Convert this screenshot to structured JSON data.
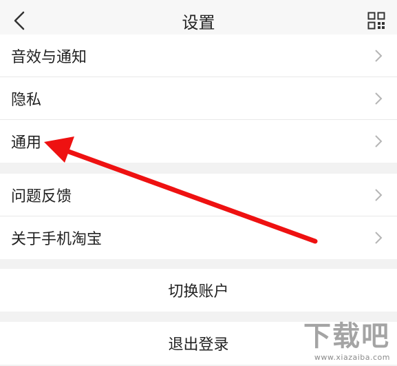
{
  "header": {
    "title": "设置"
  },
  "group1": {
    "items": [
      {
        "label": "音效与通知"
      },
      {
        "label": "隐私"
      },
      {
        "label": "通用"
      }
    ]
  },
  "group2": {
    "items": [
      {
        "label": "问题反馈"
      },
      {
        "label": "关于手机淘宝"
      }
    ]
  },
  "actions": {
    "switch_account": "切换账户",
    "logout": "退出登录"
  },
  "watermark": {
    "logo": "下载吧",
    "site": "www.xiazaiba.com"
  },
  "colors": {
    "annotation_arrow": "#ee1111",
    "background": "#f2f2f2",
    "card": "#ffffff"
  },
  "icons": [
    "chevron-left-icon",
    "qr-code-icon",
    "chevron-right-icon"
  ]
}
